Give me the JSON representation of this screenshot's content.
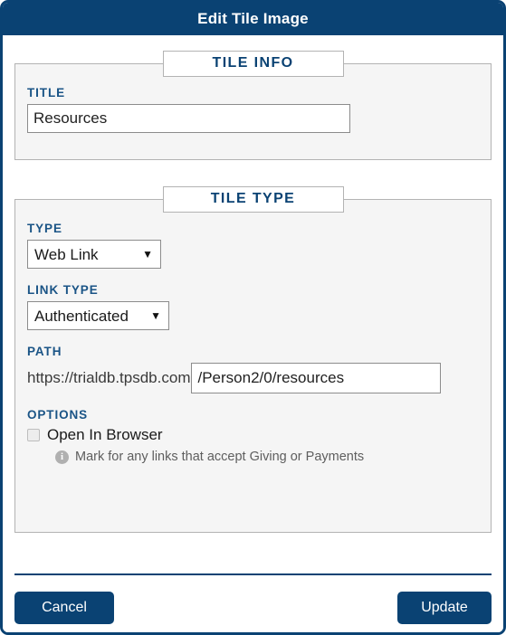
{
  "dialog": {
    "title": "Edit Tile Image"
  },
  "tile_info": {
    "legend": "TILE INFO",
    "title_label": "TITLE",
    "title_value": "Resources",
    "title_placeholder": ""
  },
  "tile_type": {
    "legend": "TILE TYPE",
    "type_label": "TYPE",
    "type_value": "Web Link",
    "type_options": [
      "Web Link"
    ],
    "type_arrow_icon": "▼",
    "link_type_label": "LINK TYPE",
    "link_type_value": "Authenticated",
    "link_type_options": [
      "Authenticated"
    ],
    "link_type_arrow_icon": "▼",
    "path_label": "PATH",
    "path_prefix": "https://trialdb.tpsdb.com",
    "path_value": "/Person2/0/resources",
    "path_placeholder": "",
    "options_label": "OPTIONS",
    "open_in_browser_label": "Open In Browser",
    "open_in_browser_checked": false,
    "info_icon": "i",
    "hint_text": "Mark for any links that accept Giving or Payments"
  },
  "footer": {
    "cancel_label": "Cancel",
    "update_label": "Update"
  },
  "colors": {
    "brand_navy": "#0a4273",
    "label_blue": "#1a5486",
    "panel_bg": "#f5f5f5",
    "panel_border": "#b3b3b3",
    "input_border": "#8c8c8c",
    "hint_gray": "#5e5e5e"
  }
}
